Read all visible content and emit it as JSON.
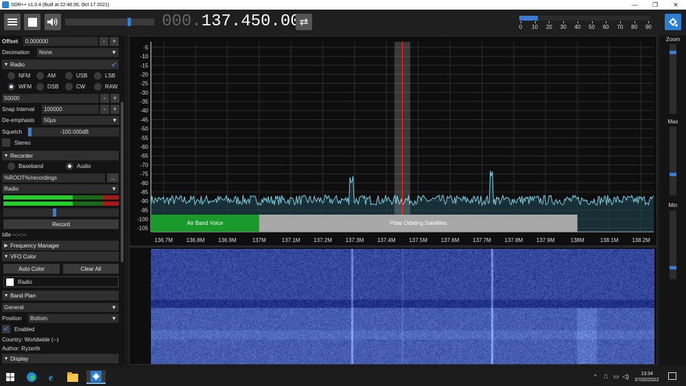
{
  "window": {
    "title": "SDR++ v1.0.4 (Built at 22:46:36, Oct 17 2021)",
    "minimize": "—",
    "maximize": "❐",
    "close": "✕"
  },
  "toolbar": {
    "menu_icon": "hamburger-icon",
    "stop_icon": "stop-icon",
    "volume_icon": "speaker-icon",
    "volume_level": 0.73,
    "frequency_dim": "000.",
    "frequency_lit": "137.450.000",
    "tuning_mode_icon": "swap-icon",
    "snr_fill": 0.14,
    "snr_ticks": [
      "0",
      "10",
      "20",
      "30",
      "40",
      "50",
      "60",
      "70",
      "80",
      "90"
    ],
    "logo_icon": "sdrpp-logo-icon"
  },
  "left_panel": {
    "offset_label": "Offset",
    "offset_value": "0.000000",
    "decimation_label": "Decimation",
    "decimation_value": "None",
    "radio_header": "Radio",
    "modes": [
      "NFM",
      "AM",
      "USB",
      "LSB",
      "WFM",
      "DSB",
      "CW",
      "RAW"
    ],
    "selected_mode": "WFM",
    "bandwidth": "50000",
    "snap_label": "Snap Interval",
    "snap_value": "100000",
    "deemph_label": "De-emphasis",
    "deemph_value": "50µs",
    "squelch_label": "Squelch",
    "squelch_value": "-100.000dB",
    "stereo_label": "Stereo",
    "recorder_header": "Recorder",
    "rec_baseband": "Baseband",
    "rec_audio": "Audio",
    "rec_path": "%ROOT%/recordings",
    "rec_browse": "...",
    "rec_stream": "Radio",
    "record_button": "Record",
    "status": "Idle --:--:--",
    "freq_manager_header": "Frequency Manager",
    "vfo_color_header": "VFO Color",
    "auto_color": "Auto Color",
    "clear_all": "Clear All",
    "vfo_name": "Radio",
    "band_plan_header": "Band Plan",
    "band_plan_value": "General",
    "position_label": "Position",
    "position_value": "Bottom",
    "enabled_label": "Enabled",
    "country": "Country: Worldwide (--)",
    "author": "Author: Ryzerth",
    "display_header": "Display",
    "minus": "-",
    "plus": "+"
  },
  "chart_data": {
    "type": "line",
    "y_ticks": [
      "-5",
      "-10",
      "-15",
      "-20",
      "-25",
      "-30",
      "-35",
      "-40",
      "-45",
      "-50",
      "-55",
      "-60",
      "-65",
      "-70",
      "-75",
      "-80",
      "-85",
      "-90",
      "-95",
      "-100",
      "-105"
    ],
    "x_ticks": [
      "136.7M",
      "136.8M",
      "136.9M",
      "137M",
      "137.1M",
      "137.2M",
      "137.3M",
      "137.4M",
      "137.5M",
      "137.6M",
      "137.7M",
      "137.8M",
      "137.9M",
      "138M",
      "138.1M",
      "138.2M"
    ],
    "xlim": [
      136.66,
      138.24
    ],
    "ylim": [
      -107,
      -2
    ],
    "vfo_center": 137.45,
    "vfo_bandwidth": 0.05,
    "noise_floor": -89.5,
    "peaks": [
      {
        "x": 137.29,
        "y": -81
      },
      {
        "x": 137.73,
        "y": -76.5
      }
    ],
    "bands": [
      {
        "name": "Air Band Voice",
        "start": 136.66,
        "end": 137.0,
        "color": "#1a9a2a"
      },
      {
        "name": "Polar Orbiting Satellites",
        "start": 137.0,
        "end": 138.0,
        "color": "#a8a8a8"
      }
    ]
  },
  "right_panel": {
    "zoom_label": "Zoom",
    "zoom_level": 0.9,
    "max_label": "Max",
    "max_level": 0.3,
    "min_label": "Min",
    "min_level": 0.15
  },
  "taskbar": {
    "time": "13:34",
    "date": "07/02/2022"
  }
}
